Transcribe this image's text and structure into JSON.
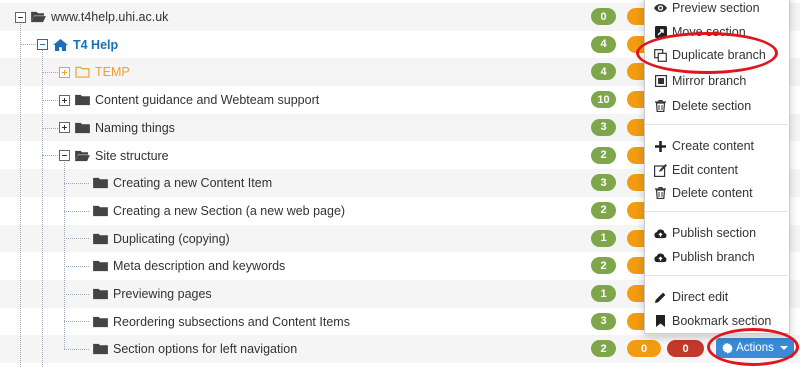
{
  "tree": {
    "rows": [
      {
        "label": "www.t4help.uhi.ac.uk",
        "count": "0",
        "style": "root"
      },
      {
        "label": "T4 Help",
        "count": "4",
        "style": "home"
      },
      {
        "label": "TEMP",
        "count": "4",
        "style": "temp"
      },
      {
        "label": "Content guidance and Webteam support",
        "count": "10",
        "style": "folder"
      },
      {
        "label": "Naming things",
        "count": "3",
        "style": "folder"
      },
      {
        "label": "Site structure",
        "count": "2",
        "style": "folder-open"
      },
      {
        "label": "Creating a new Content Item",
        "count": "3",
        "style": "folder"
      },
      {
        "label": "Creating a new Section (a new web page)",
        "count": "2",
        "style": "folder"
      },
      {
        "label": "Duplicating (copying)",
        "count": "1",
        "style": "folder"
      },
      {
        "label": "Meta description and keywords",
        "count": "2",
        "style": "folder"
      },
      {
        "label": "Previewing pages",
        "count": "1",
        "style": "folder"
      },
      {
        "label": "Reordering subsections and Content Items",
        "count": "3",
        "style": "folder"
      },
      {
        "label": "Section options for left navigation",
        "count": "2",
        "style": "folder"
      }
    ],
    "last_row_badges": {
      "orange": "0",
      "red": "0"
    }
  },
  "actions_button": {
    "label": "Actions",
    "icon": "gear-icon"
  },
  "actions_menu": {
    "items": [
      {
        "label": "Preview section",
        "icon": "eye-icon"
      },
      {
        "label": "Move section",
        "icon": "move-icon"
      },
      {
        "label": "Duplicate branch",
        "icon": "copy-icon"
      },
      {
        "label": "Mirror branch",
        "icon": "mirror-icon"
      },
      {
        "label": "Delete section",
        "icon": "trash-icon"
      },
      {
        "label": "Create content",
        "icon": "plus-icon"
      },
      {
        "label": "Edit content",
        "icon": "edit-icon"
      },
      {
        "label": "Delete content",
        "icon": "trash-icon"
      },
      {
        "label": "Publish section",
        "icon": "cloud-upload-icon"
      },
      {
        "label": "Publish branch",
        "icon": "cloud-upload-icon"
      },
      {
        "label": "Direct edit",
        "icon": "pencil-icon"
      },
      {
        "label": "Bookmark section",
        "icon": "bookmark-icon"
      }
    ]
  },
  "colors": {
    "badge_green": "#7ea64b",
    "badge_orange": "#f39c12",
    "badge_red": "#c0392b",
    "accent_blue": "#1a6fb7",
    "button_blue": "#3a8ad6",
    "highlight_ring": "#e0161c"
  }
}
